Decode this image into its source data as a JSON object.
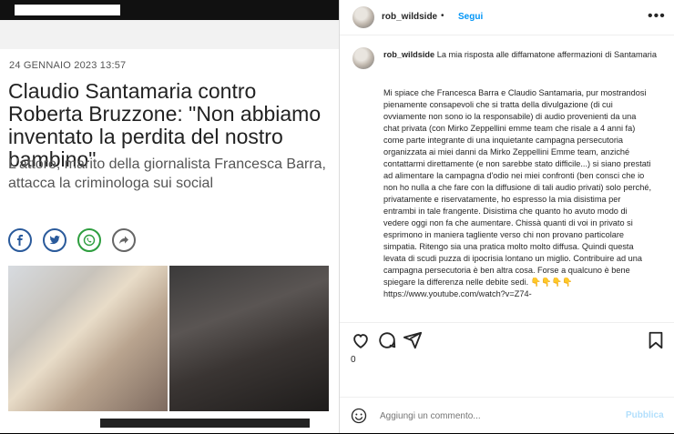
{
  "article": {
    "date": "24 GENNAIO 2023  13:57",
    "headline": "Claudio Santamaria contro Roberta Bruzzone: \"Non abbiamo inventato la perdita del nostro bambino\"",
    "subtitle": "L'attore, marito della giornalista Francesca Barra, attacca la criminologa sui social",
    "share_icons": [
      "facebook-icon",
      "twitter-icon",
      "whatsapp-icon",
      "share-icon"
    ]
  },
  "instagram": {
    "header": {
      "username": "rob_wildside",
      "separator": "•",
      "follow_label": "Segui",
      "more_label": "•••"
    },
    "caption": {
      "username": "rob_wildside",
      "intro": "La mia risposta alle diffamatone affermazioni di Santamaria",
      "body": "Mi spiace che Francesca Barra e Claudio Santamaria, pur mostrandosi pienamente consapevoli che si tratta della divulgazione (di cui ovviamente non sono io la responsabile) di audio provenienti da una chat privata (con Mirko Zeppellini emme team che risale a 4 anni fa) come parte integrante di una inquietante campagna persecutoria organizzata ai miei danni da Mirko Zeppellini Emme team, anziché contattarmi direttamente (e non sarebbe stato difficile...) si siano prestati ad alimentare la campagna d'odio nei miei confronti (ben consci che io non ho nulla a che fare con la diffusione di tali audio privati) solo perché, privatamente e riservatamente, ho espresso la mia disistima per entrambi in tale frangente. Disistima che quanto ho avuto modo di vedere oggi non fa che aumentare. Chissà quanti di voi in privato si esprimono in maniera tagliente verso chi non provano particolare simpatia. Ritengo sia una pratica molto molto diffusa. Quindi questa levata di scudi puzza di ipocrisia lontano un miglio. Contribuire ad una campagna persecutoria è ben altra cosa. Forse a qualcuno è bene spiegare la differenza nelle debite sedi. 👇👇👇👇 https://www.youtube.com/watch?v=Z74-"
    },
    "likes": "0",
    "comment_placeholder": "Aggiungi un commento...",
    "publish_label": "Pubblica"
  }
}
